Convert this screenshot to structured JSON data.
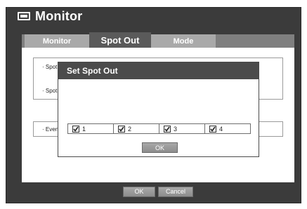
{
  "window": {
    "title": "Monitor",
    "icon": "monitor-icon"
  },
  "tabs": [
    {
      "label": "Monitor",
      "active": false
    },
    {
      "label": "Spot Out",
      "active": true
    },
    {
      "label": "Mode",
      "active": false
    }
  ],
  "groups": [
    {
      "label": "· Spot"
    },
    {
      "label": "· Spot"
    },
    {
      "label": "· Even"
    }
  ],
  "dialog": {
    "title": "Set Spot Out",
    "checkboxes": [
      {
        "label": "1",
        "checked": true
      },
      {
        "label": "2",
        "checked": true
      },
      {
        "label": "3",
        "checked": true
      },
      {
        "label": "4",
        "checked": true
      }
    ],
    "ok_label": "OK"
  },
  "footer": {
    "ok_label": "OK",
    "cancel_label": "Cancel"
  },
  "colors": {
    "frame": "#3b3b3b",
    "tab_active": "#5a5a5a",
    "tab_inactive": "#a9a9a9",
    "dialog_title": "#4b4b4b"
  }
}
